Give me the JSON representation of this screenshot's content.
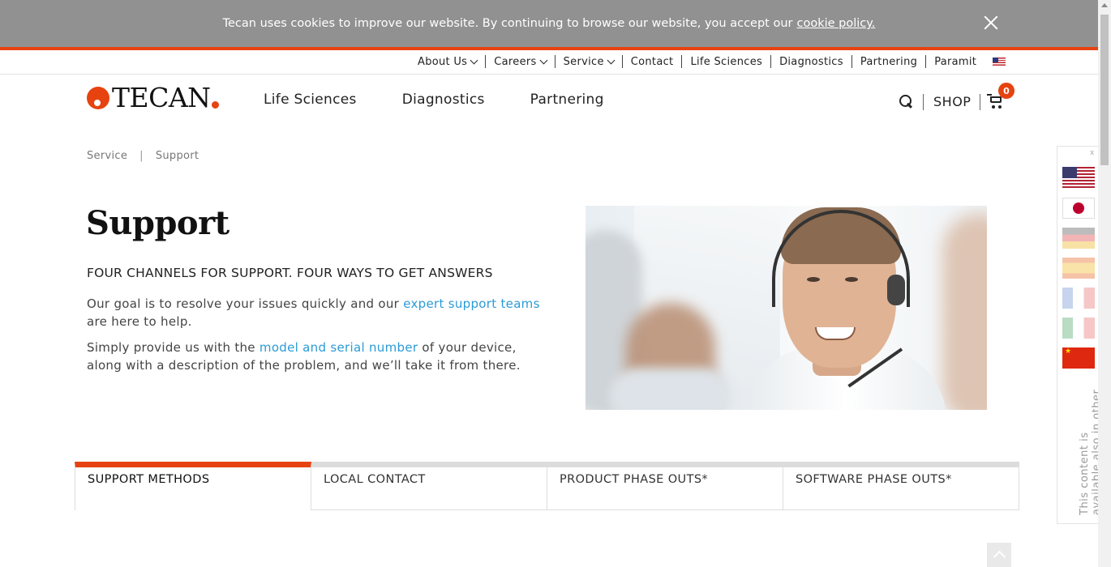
{
  "cookie_bar": {
    "message": "Tecan uses cookies to improve our website. By continuing to browse our website, you accept our",
    "link": "cookie policy."
  },
  "util_nav": {
    "items": [
      {
        "label": "About Us",
        "dropdown": true
      },
      {
        "label": "Careers",
        "dropdown": true
      },
      {
        "label": "Service",
        "dropdown": true
      },
      {
        "label": "Contact",
        "dropdown": false
      },
      {
        "label": "Life Sciences",
        "dropdown": false
      },
      {
        "label": "Diagnostics",
        "dropdown": false
      },
      {
        "label": "Partnering",
        "dropdown": false
      },
      {
        "label": "Paramit",
        "dropdown": false
      }
    ],
    "flag_icon": "us-flag-icon"
  },
  "header": {
    "logo_text": "TECAN",
    "nav": [
      "Life Sciences",
      "Diagnostics",
      "Partnering"
    ],
    "shop_label": "SHOP",
    "cart_count": "0"
  },
  "breadcrumb": [
    "Service",
    "Support"
  ],
  "main": {
    "title": "Support",
    "subtitle": "FOUR CHANNELS FOR SUPPORT. FOUR WAYS TO GET ANSWERS",
    "p1_before": "Our goal is to resolve your issues quickly and our ",
    "p1_link": "expert support teams",
    "p1_after": " are here to help.",
    "p2_before": "Simply provide us with the ",
    "p2_link": "model and serial number",
    "p2_after": " of your device, along with a description of the problem, and we’ll take it from there."
  },
  "tabs": [
    "SUPPORT METHODS",
    "LOCAL CONTACT",
    "PRODUCT PHASE OUTS*",
    "SOFTWARE PHASE OUTS*"
  ],
  "language_panel": {
    "close": "x",
    "flags": [
      "us-flag-icon",
      "japan-flag-icon",
      "germany-flag-icon",
      "spain-flag-icon",
      "france-flag-icon",
      "italy-flag-icon",
      "china-flag-icon"
    ],
    "note": "This content is available also in other languages"
  },
  "colors": {
    "accent": "#e64310",
    "link": "#2b9bd6",
    "cookie_bar": "#919191"
  }
}
